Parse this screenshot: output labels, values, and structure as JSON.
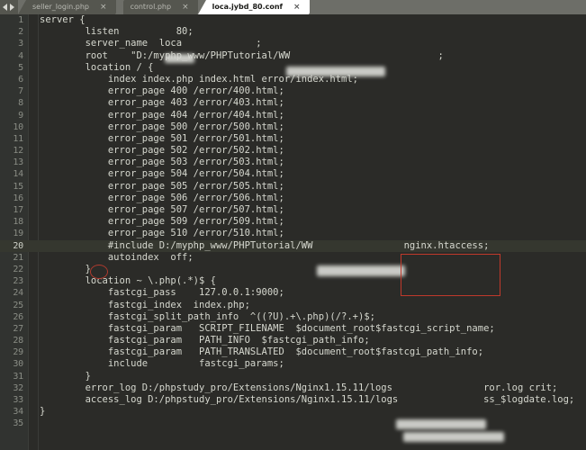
{
  "window": {
    "title": "loca.jybd_80.conf",
    "theme_bg": "#2b2b28",
    "gutter_bg": "#313330",
    "accent_red": "#c0392b"
  },
  "tabbar": {
    "nav_prev_icon": "triangle-left-icon",
    "nav_next_icon": "triangle-right-icon",
    "close_glyph": "×",
    "tabs": [
      {
        "label": "seller_login.php",
        "active": false
      },
      {
        "label": "control.php",
        "active": false
      },
      {
        "label": "loca.jybd_80.conf",
        "active": true
      }
    ]
  },
  "editor": {
    "highlighted_line": 20,
    "lines": [
      {
        "n": "1",
        "text": "server {"
      },
      {
        "n": "2",
        "text": "        listen          80;"
      },
      {
        "n": "3",
        "text": "        server_name  loca             ;"
      },
      {
        "n": "4",
        "text": "        root    \"D:/myphp_www/PHPTutorial/WW                          ;"
      },
      {
        "n": "5",
        "text": "        location / {"
      },
      {
        "n": "6",
        "text": "            index index.php index.html error/index.html;"
      },
      {
        "n": "7",
        "text": "            error_page 400 /error/400.html;"
      },
      {
        "n": "8",
        "text": "            error_page 403 /error/403.html;"
      },
      {
        "n": "9",
        "text": "            error_page 404 /error/404.html;"
      },
      {
        "n": "10",
        "text": "            error_page 500 /error/500.html;"
      },
      {
        "n": "11",
        "text": "            error_page 501 /error/501.html;"
      },
      {
        "n": "12",
        "text": "            error_page 502 /error/502.html;"
      },
      {
        "n": "13",
        "text": "            error_page 503 /error/503.html;"
      },
      {
        "n": "14",
        "text": "            error_page 504 /error/504.html;"
      },
      {
        "n": "15",
        "text": "            error_page 505 /error/505.html;"
      },
      {
        "n": "16",
        "text": "            error_page 506 /error/506.html;"
      },
      {
        "n": "17",
        "text": "            error_page 507 /error/507.html;"
      },
      {
        "n": "18",
        "text": "            error_page 509 /error/509.html;"
      },
      {
        "n": "19",
        "text": "            error_page 510 /error/510.html;"
      },
      {
        "n": "20",
        "text": "            #include D:/myphp_www/PHPTutorial/WW                nginx.htaccess;"
      },
      {
        "n": "21",
        "text": "            autoindex  off;"
      },
      {
        "n": "22",
        "text": "        }"
      },
      {
        "n": "23",
        "text": "        location ~ \\.php(.*)$ {"
      },
      {
        "n": "24",
        "text": "            fastcgi_pass    127.0.0.1:9000;"
      },
      {
        "n": "25",
        "text": "            fastcgi_index  index.php;"
      },
      {
        "n": "26",
        "text": "            fastcgi_split_path_info  ^((?U).+\\.php)(/?.+)$;"
      },
      {
        "n": "27",
        "text": "            fastcgi_param   SCRIPT_FILENAME  $document_root$fastcgi_script_name;"
      },
      {
        "n": "28",
        "text": "            fastcgi_param   PATH_INFO  $fastcgi_path_info;"
      },
      {
        "n": "29",
        "text": "            fastcgi_param   PATH_TRANSLATED  $document_root$fastcgi_path_info;"
      },
      {
        "n": "30",
        "text": "            include         fastcgi_params;"
      },
      {
        "n": "31",
        "text": "        }"
      },
      {
        "n": "32",
        "text": "        error_log D:/phpstudy_pro/Extensions/Nginx1.15.11/logs                ror.log crit;"
      },
      {
        "n": "33",
        "text": "        access_log D:/phpstudy_pro/Extensions/Nginx1.15.11/logs               ss_$logdate.log;"
      },
      {
        "n": "34",
        "text": "}"
      },
      {
        "n": "35",
        "text": ""
      }
    ]
  },
  "annotations": {
    "red_box_label": "nginx.htaccess;",
    "ellipse_target": "#"
  }
}
